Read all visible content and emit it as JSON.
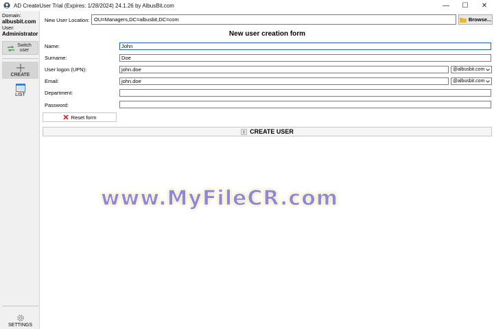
{
  "window": {
    "title": "AD CreateUser Trial (Expires: 1/28/2024) 24.1.26 by AlbusBit.com",
    "controls": [
      "—",
      "☐",
      "✕"
    ]
  },
  "sidebar": {
    "domain_label": "Domain:",
    "domain_value": "albusbit.com",
    "user_label": "User:",
    "user_value": "Administrator",
    "switch_user_label": "Switch user",
    "create_label": "CREATE",
    "list_label": "LIST",
    "settings_label": "SETTINGS"
  },
  "location": {
    "label": "New User Location:",
    "value": "OU=Managers,DC=albusbit,DC=com",
    "browse_label": "Browse..."
  },
  "form": {
    "title": "New user creation form",
    "name_label": "Name:",
    "name_value": "John",
    "surname_label": "Surname:",
    "surname_value": "Doe",
    "upn_label": "User logon (UPN):",
    "upn_value": "john.doe",
    "upn_domain": "@albusbit.com",
    "email_label": "Email:",
    "email_value": "john.doe",
    "email_domain": "@albusbit.com",
    "department_label": "Department:",
    "department_value": "",
    "password_label": "Password:",
    "password_value": "",
    "reset_label": "Reset form",
    "create_label": "CREATE USER"
  },
  "watermark": {
    "text": "www.MyFileCR.com"
  },
  "colors": {
    "accent": "#1a5fb4",
    "sidebar_bg": "#f0f0f0",
    "reset_icon": "#d9262c",
    "watermark": "#8f88d6"
  },
  "icons": {
    "app": "app-logo-icon",
    "switch": "switch-user-icon",
    "create": "plus-icon",
    "list": "list-icon",
    "settings": "gear-icon",
    "browse": "folder-icon",
    "reset": "red-x-icon"
  }
}
